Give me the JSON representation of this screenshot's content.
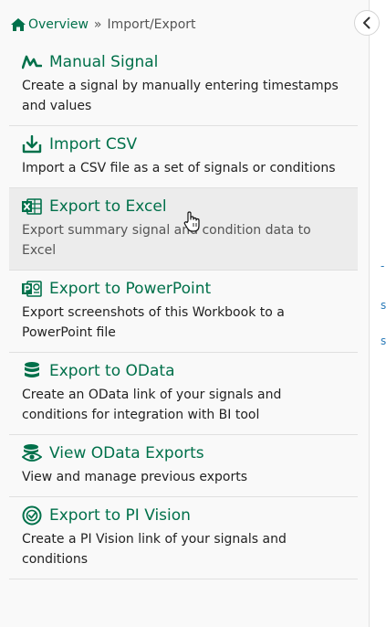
{
  "breadcrumb": {
    "home_label": "Overview",
    "separator": "»",
    "current": "Import/Export"
  },
  "items": [
    {
      "title": "Manual Signal",
      "description": "Create a signal by manually entering timestamps and values",
      "icon": "signal-wave-icon"
    },
    {
      "title": "Import CSV",
      "description": "Import a CSV file as a set of signals or conditions",
      "icon": "download-tray-icon"
    },
    {
      "title": "Export to Excel",
      "description": "Export summary signal and condition data to Excel",
      "icon": "excel-icon",
      "state": "hovered"
    },
    {
      "title": "Export to PowerPoint",
      "description": "Export screenshots of this Workbook to a PowerPoint file",
      "icon": "powerpoint-icon"
    },
    {
      "title": "Export to OData",
      "description": "Create an OData link of your signals and conditions for integration with BI tool",
      "icon": "database-icon"
    },
    {
      "title": "View OData Exports",
      "description": "View and manage previous exports",
      "icon": "database-view-icon"
    },
    {
      "title": "Export to PI Vision",
      "description": "Create a PI Vision link of your signals and conditions",
      "icon": "pi-vision-icon"
    }
  ],
  "right_panel_fragments": [
    "-",
    "s",
    "s"
  ],
  "colors": {
    "accent": "#00704a",
    "hover_bg": "#ececec",
    "link": "#2a7ab8"
  }
}
